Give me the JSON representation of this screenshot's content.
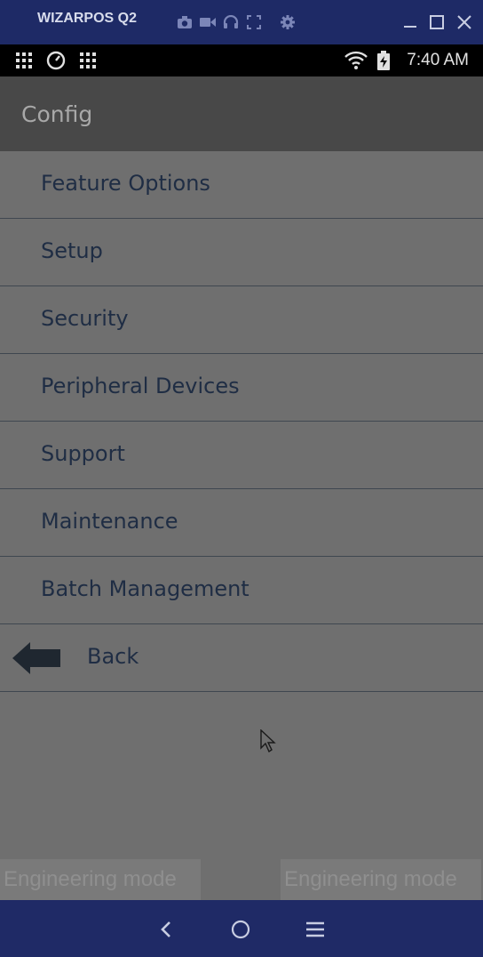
{
  "window": {
    "title": "WIZARPOS Q2",
    "toolbar_icons": [
      "camera-icon",
      "video-icon",
      "headphones-icon",
      "fullscreen-icon",
      "settings-icon"
    ],
    "controls": [
      "minimize-icon",
      "maximize-icon",
      "close-icon"
    ]
  },
  "status_bar": {
    "left_icons": [
      "apps-grid-icon",
      "speedometer-icon",
      "apps-grid-icon"
    ],
    "right_icons": [
      "wifi-icon",
      "battery-charging-icon"
    ],
    "time": "7:40 AM"
  },
  "app_bar": {
    "title": "Config"
  },
  "menu": {
    "items": [
      {
        "label": "Feature Options"
      },
      {
        "label": "Setup"
      },
      {
        "label": "Security"
      },
      {
        "label": "Peripheral Devices"
      },
      {
        "label": "Support"
      },
      {
        "label": "Maintenance"
      },
      {
        "label": "Batch Management"
      }
    ],
    "back": {
      "label": "Back",
      "icon": "back-arrow-icon"
    }
  },
  "footer": {
    "left_label": "Engineering mode",
    "right_label": "Engineering mode"
  },
  "nav_bar": {
    "buttons": [
      "back-nav-icon",
      "home-nav-icon",
      "menu-nav-icon"
    ]
  },
  "colors": {
    "window_frame": "#1e2a66",
    "app_bar": "#484848",
    "background": "#6f6f6f",
    "text": "#1f2d44"
  }
}
